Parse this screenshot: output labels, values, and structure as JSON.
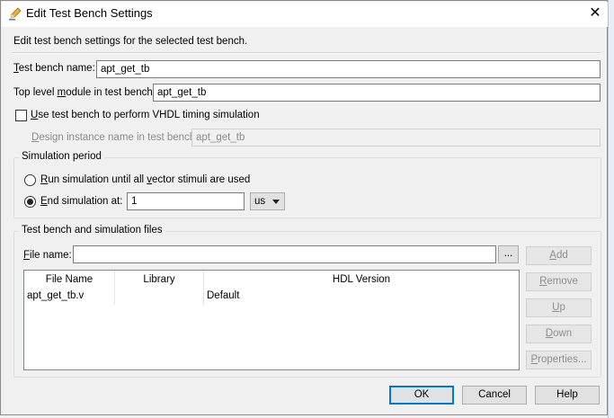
{
  "dialog": {
    "title": "Edit Test Bench Settings",
    "close_symbol": "✕",
    "description": "Edit test bench settings for the selected test bench."
  },
  "fields": {
    "test_bench_name": {
      "label_pre": "",
      "label_u": "T",
      "label_post": "est bench name:",
      "value": "apt_get_tb"
    },
    "top_level_module": {
      "label_pre": "Top level ",
      "label_u": "m",
      "label_post": "odule in test bench:",
      "value": "apt_get_tb"
    },
    "use_vhdl_timing": {
      "label_pre": "",
      "label_u": "U",
      "label_post": "se test bench to perform VHDL timing simulation",
      "checked": false
    },
    "design_instance": {
      "label_pre": "",
      "label_u": "D",
      "label_post": "esign instance name in test bench:",
      "value": "apt_get_tb",
      "disabled": true
    }
  },
  "simulation_period": {
    "title": "Simulation period",
    "run_all": {
      "label_pre": "",
      "label_u": "R",
      "label_post": "un simulation until all ",
      "label_u2": "v",
      "label_post2": "ector stimuli are used",
      "selected": false
    },
    "end_at": {
      "label_pre": "",
      "label_u": "E",
      "label_post": "nd simulation at:",
      "selected": true,
      "value": "1",
      "unit": "us"
    }
  },
  "files": {
    "title": "Test bench and simulation files",
    "file_name_label_u": "F",
    "file_name_label_post": "ile name:",
    "file_name_value": "",
    "browse_label": "...",
    "columns": [
      "File Name",
      "Library",
      "HDL Version"
    ],
    "rows": [
      {
        "file": "apt_get_tb.v",
        "library": "",
        "hdl": "Default"
      }
    ],
    "buttons": {
      "add": {
        "u": "A",
        "rest": "dd"
      },
      "remove": {
        "u": "R",
        "rest": "emove"
      },
      "up": {
        "u": "U",
        "rest": "p"
      },
      "down": {
        "u": "D",
        "rest": "own"
      },
      "properties": {
        "u": "P",
        "rest": "roperties..."
      }
    }
  },
  "footer": {
    "ok": "OK",
    "cancel": "Cancel",
    "help": "Help"
  },
  "colors": {
    "accent": "#0078d7",
    "disabled_text": "#8a8a8a"
  },
  "icons": {
    "title_icon": "edit-pencil-icon",
    "close_icon": "close-icon"
  }
}
